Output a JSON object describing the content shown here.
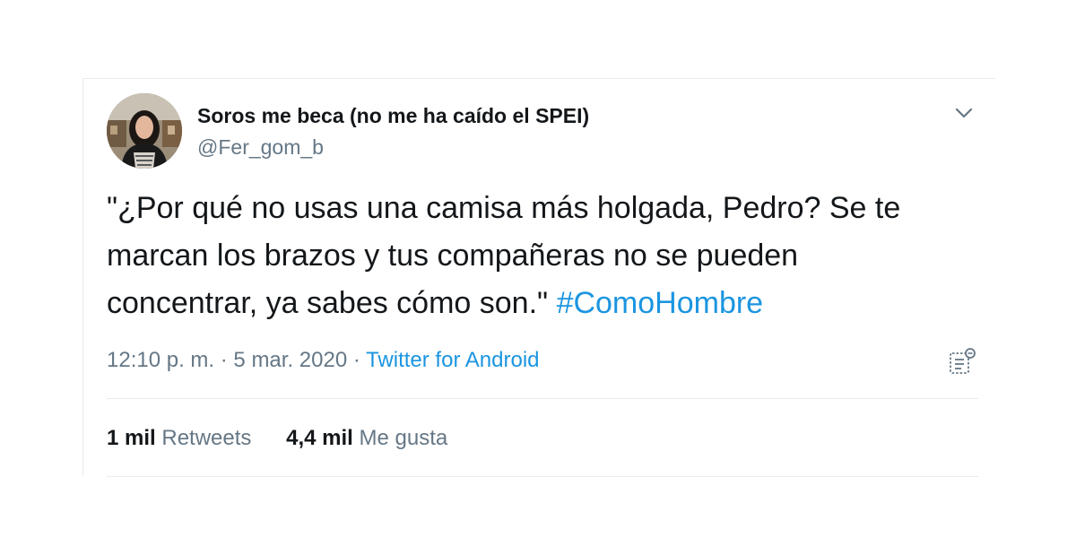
{
  "user": {
    "display_name": "Soros me beca (no me ha caído el SPEI)",
    "handle": "@Fer_gom_b"
  },
  "tweet": {
    "text": "\"¿Por qué no usas una camisa más holgada, Pedro? Se te marcan los brazos y tus compañeras no se pueden concentrar, ya sabes cómo son.\"",
    "hashtag": "#ComoHombre"
  },
  "meta": {
    "time": "12:10 p. m.",
    "separator": "·",
    "date": "5 mar. 2020",
    "source": "Twitter for Android"
  },
  "stats": {
    "retweets_count": "1 mil",
    "retweets_label": "Retweets",
    "likes_count": "4,4 mil",
    "likes_label": "Me gusta"
  },
  "icons": {
    "caret": "chevron-down-icon",
    "analytics": "analytics-icon"
  },
  "colors": {
    "text": "#14171a",
    "secondary": "#657786",
    "link": "#1b95e0",
    "divider": "#e6ecf0"
  }
}
